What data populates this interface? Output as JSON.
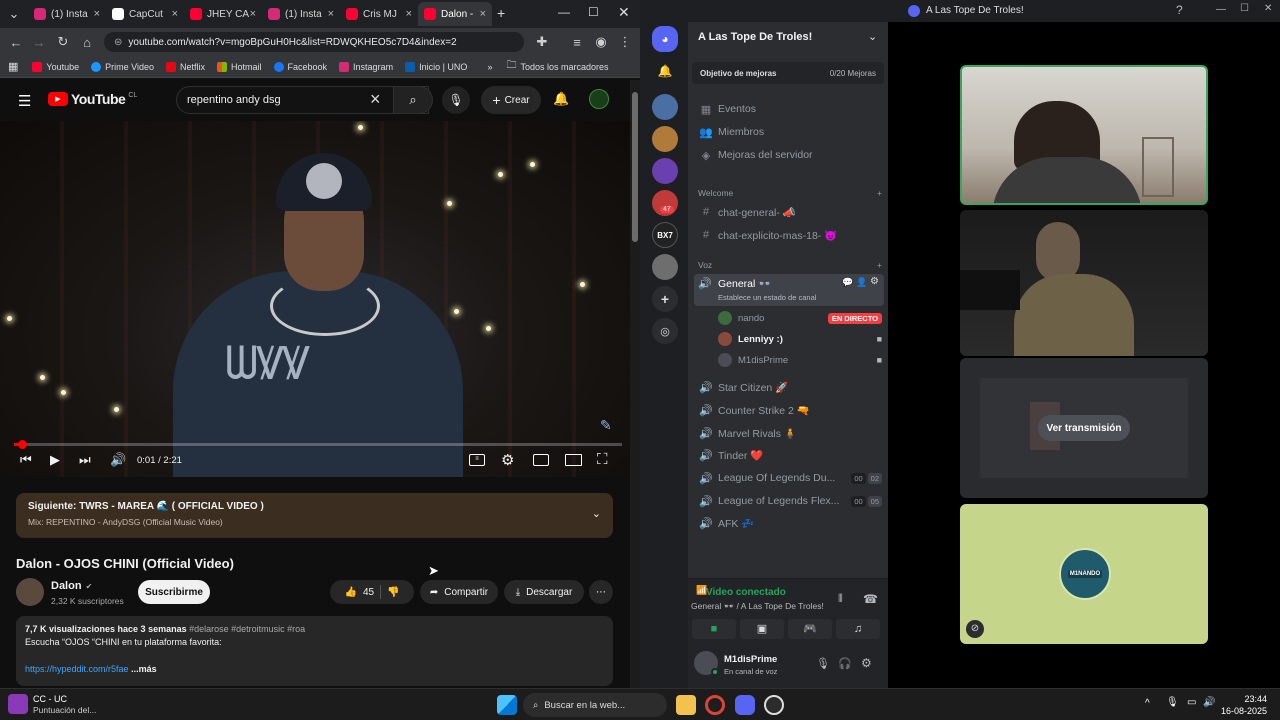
{
  "chrome": {
    "tabs": [
      {
        "label": "(1) Insta",
        "color": "#d62976"
      },
      {
        "label": "CapCut",
        "color": "#ffffff"
      },
      {
        "label": "JHEY CA",
        "color": "#ff0033"
      },
      {
        "label": "(1) Insta",
        "color": "#d62976"
      },
      {
        "label": "Cris MJ",
        "color": "#ff0033"
      },
      {
        "label": "Dalon -",
        "color": "#ff0033"
      }
    ],
    "url": "youtube.com/watch?v=mgoBpGuH0Hc&list=RDWQKHEO5c7D4&index=2",
    "bookmarks": [
      "Youtube",
      "Prime Video",
      "Netflix",
      "Hotmail",
      "Facebook",
      "Instagram",
      "Inicio | UNO"
    ],
    "bookmarks_folder": "Todos los marcadores"
  },
  "youtube": {
    "logo": "YouTube",
    "region": "CL",
    "search_value": "repentino andy dsg",
    "create_label": "Crear",
    "time": "0:01 / 2:21",
    "progress": 0.01,
    "up_next_title": "Siguiente: TWRS - MAREA 🌊 ( OFFICIAL VIDEO )",
    "up_next_sub": "Mix: REPENTINO - AndyDSG (Official Music Video)",
    "video_title": "Dalon - OJOS CHINI (Official Video)",
    "channel_name": "Dalon",
    "subscribers": "2,32 K suscriptores",
    "subscribe_label": "Suscribirme",
    "likes": "45",
    "share_label": "Compartir",
    "download_label": "Descargar",
    "views_line": "7,7 K visualizaciones  hace 3 semanas",
    "hashtags": "#delarose #detroitmusic #roa",
    "desc_line": "Escucha “OJOS “CHINI en tu plataforma favorita:",
    "link": "https://hypeddit.com/r5fae",
    "more": "...más"
  },
  "discord": {
    "window_title": "A Las Tope De Troles!",
    "server_name": "A Las Tope De Troles!",
    "boost_goal": "Objetivo de mejoras",
    "boost_count": "0/20 Mejoras",
    "menu": [
      "Eventos",
      "Miembros",
      "Mejoras del servidor"
    ],
    "welcome_section": "Welcome",
    "text_channels": [
      "chat-general- 📣",
      "chat-explicito-mas-18- 👿"
    ],
    "voice_section": "Voz",
    "general_channel": "General 👓",
    "general_status": "Establece un estado de canal",
    "voice_users": [
      {
        "name": "nando",
        "live": "EN DIRECTO"
      },
      {
        "name": "Lenniyy :)",
        "live": ""
      },
      {
        "name": "M1disPrime",
        "live": ""
      }
    ],
    "voice_channels": [
      {
        "name": "Star Citizen 🚀",
        "c1": "",
        "c2": ""
      },
      {
        "name": "Counter Strike 2 🔫",
        "c1": "",
        "c2": ""
      },
      {
        "name": "Marvel Rivals 🧍",
        "c1": "",
        "c2": ""
      },
      {
        "name": "Tinder ❤️",
        "c1": "",
        "c2": ""
      },
      {
        "name": "League Of Legends Du...",
        "c1": "00",
        "c2": "02"
      },
      {
        "name": "League of Legends Flex...",
        "c1": "00",
        "c2": "05"
      },
      {
        "name": "AFK 💤",
        "c1": "",
        "c2": ""
      }
    ],
    "guild_badge": "47",
    "guild_label": "BX7",
    "connection": "Video conectado",
    "connection_sub": "General 👓 / A Las Tope De Troles!",
    "user_name": "M1disPrime",
    "user_status": "En canal de voz",
    "watch_stream": "Ver transmisión",
    "stream_logo_text": "M1NANDO"
  },
  "taskbar": {
    "widget_title": "CC - UC",
    "widget_sub": "Puntuación del...",
    "search": "Buscar en la web...",
    "time": "23:44",
    "date": "16-08-2025"
  }
}
